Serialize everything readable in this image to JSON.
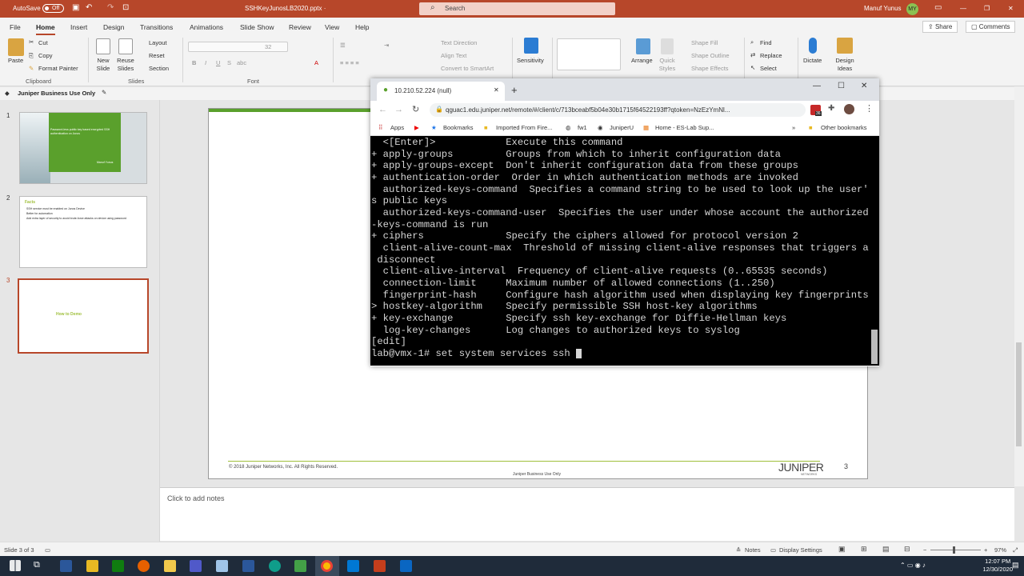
{
  "window": {
    "autosave_label": "AutoSave",
    "autosave_state": "Off",
    "file_name": "SSHKeyJunosLB2020.pptx ·",
    "search_placeholder": "Search",
    "user_name": "Manuf Yunus",
    "user_initials": "MY"
  },
  "menu": {
    "tabs": [
      "File",
      "Home",
      "Insert",
      "Design",
      "Transitions",
      "Animations",
      "Slide Show",
      "Review",
      "View",
      "Help"
    ],
    "share_label": "Share",
    "comments_label": "Comments"
  },
  "ribbon": {
    "clipboard": {
      "paste": "Paste",
      "cut": "Cut",
      "copy": "Copy",
      "format_painter": "Format Painter",
      "group": "Clipboard"
    },
    "slides": {
      "new_slide": "New Slide",
      "reuse_slides": "Reuse Slides",
      "layout": "Layout",
      "reset": "Reset",
      "section": "Section",
      "group": "Slides"
    },
    "font": {
      "size": "32",
      "group": "Font"
    },
    "paragraph": {
      "text_direction": "Text Direction",
      "align_text": "Align Text",
      "convert_smartart": "Convert to SmartArt"
    },
    "sensitivity": "Sensitivity",
    "drawing": {
      "arrange": "Arrange",
      "quick_styles": "Quick Styles",
      "shape_fill": "Shape Fill",
      "shape_outline": "Shape Outline",
      "shape_effects": "Shape Effects"
    },
    "editing": {
      "find": "Find",
      "replace": "Replace",
      "select": "Select"
    },
    "dictate": "Dictate",
    "design_ideas": "Design Ideas"
  },
  "sensitivity_label": "Juniper Business Use Only",
  "thumbnails": [
    {
      "num": "1",
      "title": "Password-less public key based encrypted SSH authentication on Junos",
      "author": "Manuf Yunus"
    },
    {
      "num": "2",
      "title": "Facts",
      "bullets": [
        "SSH service must be enabled on Junos Device",
        "Better for automation",
        "Add extra layer of security to avoid brute-force attacks on device using password"
      ]
    },
    {
      "num": "3",
      "title": "How to Demo"
    }
  ],
  "slide": {
    "copyright": "© 2018 Juniper Networks, Inc. All Rights Reserved.",
    "footer": "Juniper Business Use Only",
    "logo": "JUNIPER",
    "logo_sub": "NETWORKS",
    "page": "3"
  },
  "notes_placeholder": "Click to add notes",
  "browser": {
    "tab_title": "10.210.52.224 (null)",
    "url": "qguac1.edu.juniper.net/remote/#/client/c/713bceabf5b04e30b1715f64522193ff?qtoken=NzEzYmNl...",
    "bookmarks": [
      "Apps",
      "Bookmarks",
      "Imported From Fire...",
      "fw1",
      "JuniperU",
      "Home - ES-Lab Sup..."
    ],
    "other_bookmarks": "Other bookmarks",
    "ext_badge": "36"
  },
  "terminal": {
    "lines": [
      "  <[Enter]>            Execute this command",
      "+ apply-groups         Groups from which to inherit configuration data",
      "+ apply-groups-except  Don't inherit configuration data from these groups",
      "+ authentication-order  Order in which authentication methods are invoked",
      "  authorized-keys-command  Specifies a command string to be used to look up the user'",
      "s public keys",
      "  authorized-keys-command-user  Specifies the user under whose account the authorized",
      "-keys-command is run",
      "+ ciphers              Specify the ciphers allowed for protocol version 2",
      "  client-alive-count-max  Threshold of missing client-alive responses that triggers a",
      " disconnect",
      "  client-alive-interval  Frequency of client-alive requests (0..65535 seconds)",
      "  connection-limit     Maximum number of allowed connections (1..250)",
      "  fingerprint-hash     Configure hash algorithm used when displaying key fingerprints",
      "> hostkey-algorithm    Specify permissible SSH host-key algorithms",
      "+ key-exchange         Specify ssh key-exchange for Diffie-Hellman keys",
      "  log-key-changes      Log changes to authorized keys to syslog",
      "[edit]"
    ],
    "prompt": "lab@vmx-1# set system services ssh "
  },
  "status": {
    "slide_of": "Slide 3 of 3",
    "notes": "Notes",
    "display_settings": "Display Settings",
    "zoom": "97%"
  },
  "clock": {
    "time": "12:07 PM",
    "date": "12/30/2020"
  },
  "colors": {
    "accent": "#b7472a",
    "slide_green": "#5aa02c",
    "thumb_title": "#9fbf3b"
  }
}
